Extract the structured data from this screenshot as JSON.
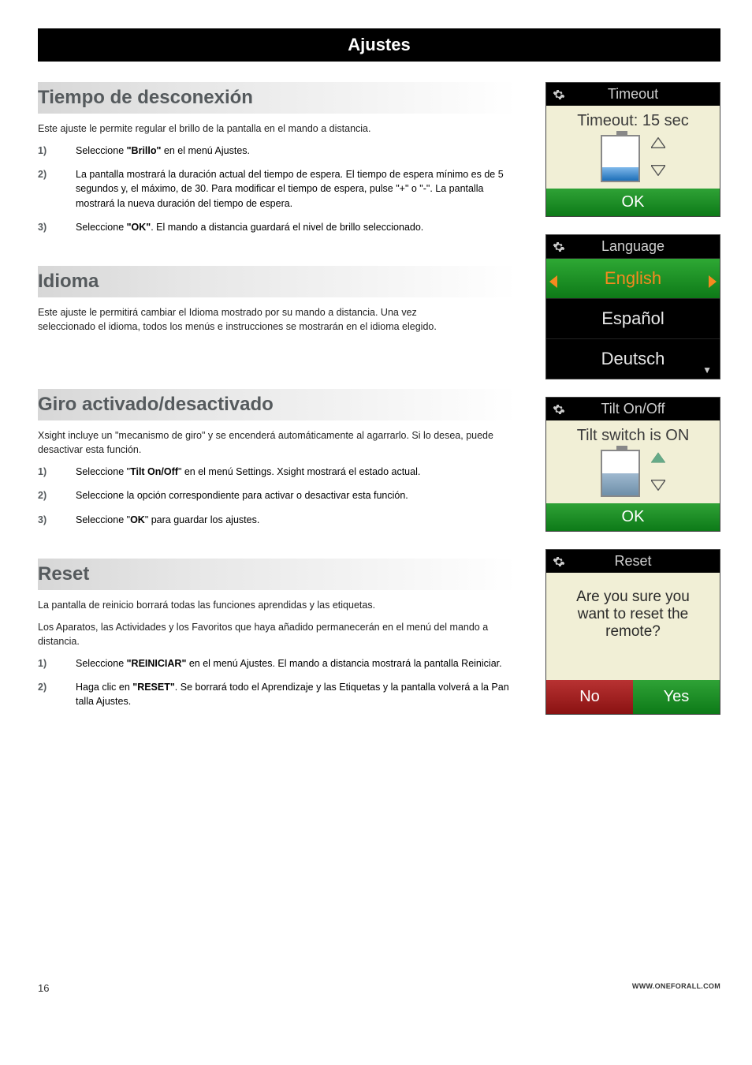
{
  "header": {
    "title": "Ajustes"
  },
  "sections": {
    "timeout": {
      "heading": "Tiempo de desconexión",
      "intro": "Este ajuste le permite regular el brillo de la pantalla en el mando a distancia.",
      "steps": [
        {
          "n": "1)",
          "pre": "Seleccione ",
          "bold": "\"Brillo\"",
          "post": " en el menú Ajustes."
        },
        {
          "n": "2)",
          "text": "La pantalla mostrará la duración actual del tiempo de espera. El tiempo de espera mínimo es de 5 segundos y, el máximo, de 30. Para modificar el tiempo de espera, pulse \"+\" o \"-\". La pantalla mostrará la nueva duración del tiempo de espera."
        },
        {
          "n": "3)",
          "pre": "Seleccione ",
          "bold": "\"OK\"",
          "post": ".  El mando a distancia guardará el nivel de brillo seleccionado."
        }
      ]
    },
    "idioma": {
      "heading": "Idioma",
      "intro": "Este ajuste le permitirá cambiar el Idioma mostrado por su mando a distancia. Una vez seleccionado el idioma, todos los menús e instrucciones se mostrarán en el idioma elegido."
    },
    "tilt": {
      "heading": "Giro activado/desactivado",
      "intro": "Xsight incluye un \"mecanismo de giro\" y se encenderá automáticamente al agarrarlo. Si lo desea, puede desactivar esta función.",
      "steps": [
        {
          "n": "1)",
          "pre": "Seleccione \"",
          "bold": "Tilt On/Off",
          "post": "\" en el menú Settings. Xsight mostrará el estado actual."
        },
        {
          "n": "2)",
          "text": "Seleccione la opción correspondiente para activar o desactivar esta función."
        },
        {
          "n": "3)",
          "pre": "Seleccione \"",
          "bold": "OK",
          "post": "\" para guardar los ajustes."
        }
      ]
    },
    "reset": {
      "heading": "Reset",
      "intro1": "La pantalla de reinicio borrará todas las funciones aprendidas y las etiquetas.",
      "intro2": "Los Aparatos, las Actividades y los Favoritos que haya añadido permanecerán en el menú del mando a distancia.",
      "steps": [
        {
          "n": "1)",
          "pre": "Seleccione ",
          "bold": "\"REINICIAR\"",
          "post": " en el menú Ajustes. El mando a distancia mostrará la pantalla Reiniciar."
        },
        {
          "n": "2)",
          "pre": "Haga clic en ",
          "bold": "\"RESET\"",
          "post": ". Se borrará todo el Aprendizaje y las Etiquetas y la pantalla volverá a la Pan talla Ajustes."
        }
      ]
    }
  },
  "panels": {
    "timeout": {
      "title": "Timeout",
      "line": "Timeout: 15 sec",
      "ok": "OK"
    },
    "language": {
      "title": "Language",
      "items": [
        "English",
        "Español",
        "Deutsch"
      ],
      "selected": 0
    },
    "tilt": {
      "title": "Tilt On/Off",
      "line": "Tilt switch is ON",
      "ok": "OK"
    },
    "reset": {
      "title": "Reset",
      "msg": "Are you sure you want to reset the remote?",
      "no": "No",
      "yes": "Yes"
    }
  },
  "footer": {
    "page": "16",
    "url": "WWW.ONEFORALL.COM"
  }
}
